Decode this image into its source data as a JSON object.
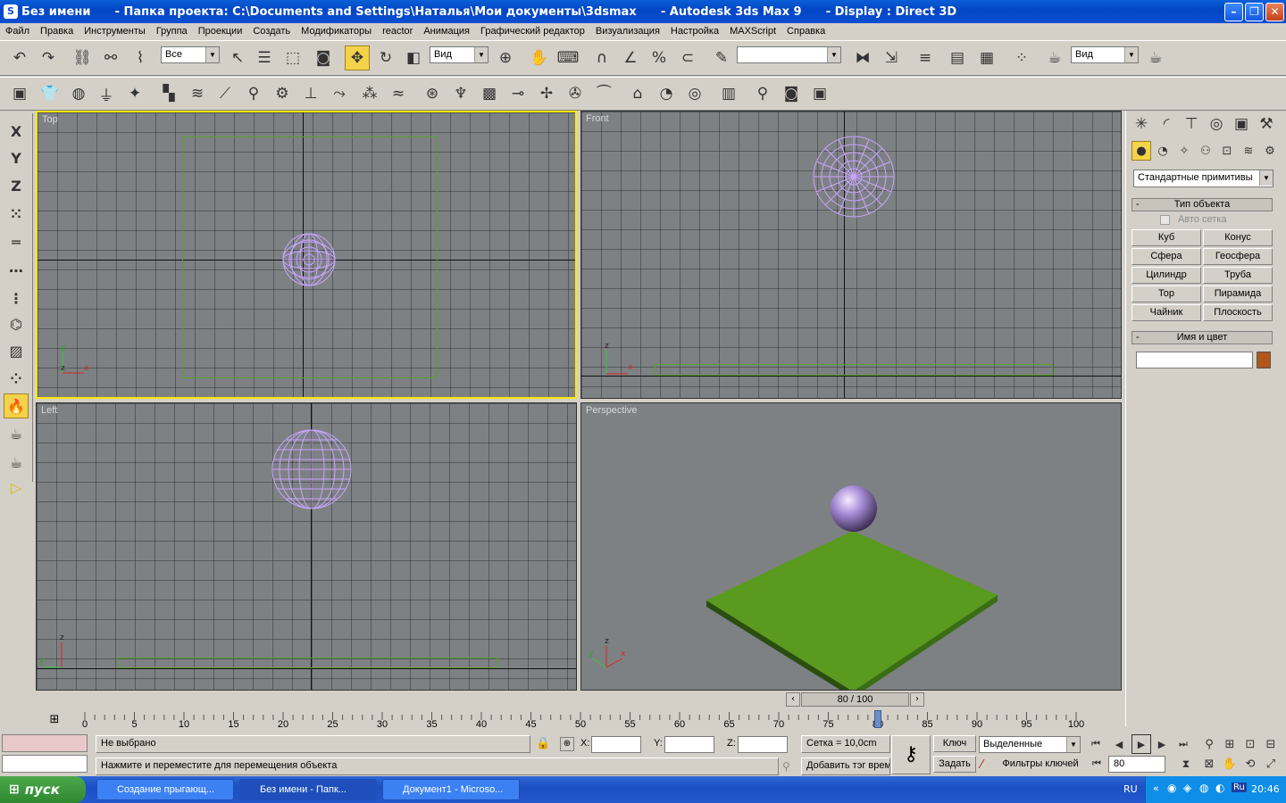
{
  "window": {
    "title": "Без имени      - Папка проекта: C:\\Documents and Settings\\Наталья\\Мои документы\\3dsmax      - Autodesk 3ds Max 9      - Display : Direct 3D"
  },
  "menu": [
    "Файл",
    "Правка",
    "Инструменты",
    "Группа",
    "Проекции",
    "Создать",
    "Модификаторы",
    "reactor",
    "Анимация",
    "Графический редактор",
    "Визуализация",
    "Настройка",
    "MAXScript",
    "Справка"
  ],
  "toolbar": {
    "selection_filter": "Все",
    "ref_coord": "Вид",
    "named_selection": "",
    "render_type": "Вид"
  },
  "left_toolbar": [
    "X",
    "Y",
    "Z"
  ],
  "viewports": {
    "top": "Top",
    "front": "Front",
    "left": "Left",
    "perspective": "Perspective"
  },
  "axis_letters": {
    "x": "x",
    "y": "y",
    "z": "z"
  },
  "command_panel": {
    "category": "Стандартные примитивы",
    "object_type_title": "Тип объекта",
    "collapse": "-",
    "auto_grid": "Авто сетка",
    "buttons": [
      "Куб",
      "Конус",
      "Сфера",
      "Геосфера",
      "Цилиндр",
      "Труба",
      "Тор",
      "Пирамида",
      "Чайник",
      "Плоскость"
    ],
    "name_color_title": "Имя и цвет",
    "name_value": "",
    "object_color": "#b0561a"
  },
  "time": {
    "slider_label": "80 / 100",
    "current_frame": 80,
    "total_frames": 100,
    "ticks": [
      "0",
      "5",
      "10",
      "15",
      "20",
      "25",
      "30",
      "35",
      "40",
      "45",
      "50",
      "55",
      "60",
      "65",
      "70",
      "75",
      "80",
      "85",
      "90",
      "95",
      "100"
    ]
  },
  "status": {
    "selection": "Не выбрано",
    "prompt": "Нажмите и переместите для перемещения объекта",
    "x_label": "X:",
    "y_label": "Y:",
    "z_label": "Z:",
    "grid": "Сетка = 10,0cm",
    "add_tag": "Добавить тэг врем",
    "key_label": "Ключ",
    "set_label": "Задать",
    "key_mode": "Выделенные",
    "key_filters": "Фильтры ключей",
    "frame": "80"
  },
  "taskbar": {
    "start": "пуск",
    "tasks": [
      "Создание прыгающ...",
      "Без имени      - Папк...",
      "Документ1 - Microso..."
    ],
    "lang": "RU",
    "tray_lang": "Ru",
    "clock": "20:46"
  },
  "colors": {
    "viewport_bg": "#7d8183",
    "active_border": "#ffe800",
    "wire": "#c9a4ff",
    "plane": "#5a9a1e"
  }
}
